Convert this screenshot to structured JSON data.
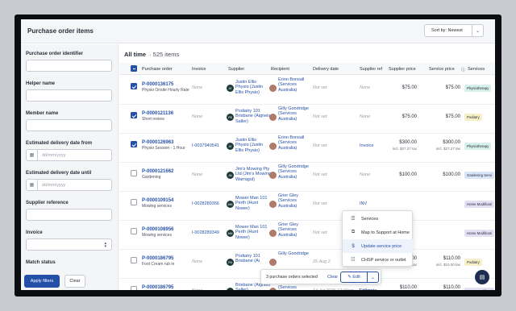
{
  "page": {
    "title": "Purchase order items",
    "sort_label": "Sort by: Newest"
  },
  "filters": {
    "po_identifier": {
      "label": "Purchase order identifier",
      "placeholder": ""
    },
    "helper_name": {
      "label": "Helper name",
      "placeholder": ""
    },
    "member_name": {
      "label": "Member name",
      "placeholder": ""
    },
    "delivery_from": {
      "label": "Estimated delivery date from",
      "placeholder": "dd/mm/yyyy"
    },
    "delivery_until": {
      "label": "Estimated delivery date until",
      "placeholder": "dd/mm/yyyy"
    },
    "supplier_ref": {
      "label": "Supplier reference",
      "placeholder": ""
    },
    "invoice": {
      "label": "Invoice",
      "placeholder": ""
    },
    "match_status": {
      "label": "Match status"
    },
    "apply_label": "Apply filters",
    "clear_label": "Clear"
  },
  "list": {
    "scope": "All time",
    "count": "· 525 items",
    "columns": {
      "po": "Purchase order",
      "invoice": "Invoice",
      "supplier": "Supplier",
      "recipient": "Recipient",
      "delivery": "Delivery date",
      "supplier_ref": "Supplier ref",
      "supplier_price": "Supplier price",
      "service_price": "Service price",
      "services": "Services"
    },
    "rows": [
      {
        "po": "P-0000136175",
        "desc": "Physio Onsite Hourly Rate",
        "invoice": "None",
        "sup_init": "JE",
        "supplier": "Justin Ellis Physio (Justin Ellis Physio)",
        "recipient": "Erinn Bonsall (Services Australia)",
        "delivery": "Not set",
        "supplier_ref": "None",
        "supplier_price": "$75.00",
        "supplier_tax": "",
        "service_price": "$75.00",
        "service_tax": "",
        "service": "Physiotherapy",
        "checked": true
      },
      {
        "po": "P-0000121136",
        "desc": "Short review",
        "invoice": "None",
        "sup_init": "PB",
        "supplier": "Podiatry 101 Brisbane (Aigneis Saller)",
        "recipient": "Gilly Goodridge (Services Australia)",
        "delivery": "Not set",
        "supplier_ref": "None",
        "supplier_price": "$75.00",
        "supplier_tax": "",
        "service_price": "$75.00",
        "service_tax": "",
        "service": "Podiatry",
        "checked": true
      },
      {
        "po": "P-0000126963",
        "desc": "Physio Session - 1 Hour",
        "invoice": "I-0037940541",
        "sup_init": "JE",
        "supplier": "Justin Ellis Physio (Justin Ellis Physio)",
        "recipient": "Erinn Bonsall (Services Australia)",
        "delivery": "Not set",
        "supplier_ref": "Invoice",
        "supplier_price": "$300.00",
        "supplier_tax": "incl. $27.27 tax",
        "service_price": "$300.00",
        "service_tax": "incl. $27.27 tax",
        "service": "Physiotherapy",
        "checked": true
      },
      {
        "po": "P-0000121662",
        "desc": "Gardening",
        "invoice": "None",
        "sup_init": "JM",
        "supplier": "Jim's Mowing Pty Ltd (Jim's Mowing Warragul)",
        "recipient": "Gilly Goodridge (Services Australia)",
        "delivery": "Not set",
        "supplier_ref": "None",
        "supplier_price": "$100.00",
        "supplier_tax": "",
        "service_price": "$100.00",
        "service_tax": "",
        "service": "Gardening Servi",
        "checked": false
      },
      {
        "po": "P-0000109154",
        "desc": "Mowing services",
        "invoice": "I-0028289356",
        "sup_init": "MM",
        "supplier": "Mower Man 101 Perth (Hunt Nower)",
        "recipient": "Grier Gley (Services Australia)",
        "delivery": "Not set",
        "supplier_ref": "INV",
        "supplier_price": "",
        "supplier_tax": "",
        "service_price": "",
        "service_tax": "",
        "service": "Home Modificati",
        "checked": false
      },
      {
        "po": "P-0000108956",
        "desc": "Mowing services",
        "invoice": "I-0028289349",
        "sup_init": "MM",
        "supplier": "Mower Man 101 Perth (Hunt Nower)",
        "recipient": "Grier Gley (Services Australia)",
        "delivery": "Not set",
        "supplier_ref": "",
        "supplier_price": "",
        "supplier_tax": "",
        "service_price": "",
        "service_tax": "",
        "service": "Home Modificati",
        "checked": false
      },
      {
        "po": "P-0000186795",
        "desc": "Foot Cream rub in",
        "invoice": "None",
        "sup_init": "PB",
        "supplier": "Podiatry 101 Brisbane (Ai",
        "recipient": "Gilly Goodridge",
        "delivery": "25 Aug 2",
        "supplier_ref": "",
        "supplier_price": "$110.00",
        "supplier_tax": "incl. $10.00 tax",
        "service_price": "$110.00",
        "service_tax": "incl. $10.00 tax",
        "service": "Podiatry",
        "checked": false
      },
      {
        "po": "P-0000186795",
        "desc": "Foot Cream rub in",
        "invoice": "None",
        "sup_init": "PB",
        "supplier": "Brisbane (Aigneis Saller)",
        "recipient": "Goodridge (Services",
        "delivery": "14 Jul 2026 12:00pm - 1:00pm",
        "supplier_ref": "Estimate",
        "supplier_price": "$110.00",
        "supplier_tax": "incl. $10.00 tax",
        "service_price": "$110.00",
        "service_tax": "incl. $10.00 tax",
        "service": "Home Modificati",
        "checked": false
      }
    ]
  },
  "menu": {
    "items": [
      {
        "icon": "list-icon",
        "label": "Services"
      },
      {
        "icon": "map-icon",
        "label": "Map to Support at Home"
      },
      {
        "icon": "dollar-icon",
        "label": "Update service price"
      },
      {
        "icon": "outlet-icon",
        "label": "CHSP service or outlet"
      }
    ]
  },
  "actionbar": {
    "selected_text": "3 purchase orders selected",
    "clear_label": "Clear",
    "edit_label": "Edit"
  },
  "colors": {
    "accent": "#2450a8",
    "physio_badge": "#d6f0ea",
    "podiatry_badge": "#f6f0c8",
    "gardening_badge": "#d9e6f8",
    "home_badge": "#e4e0f4"
  }
}
